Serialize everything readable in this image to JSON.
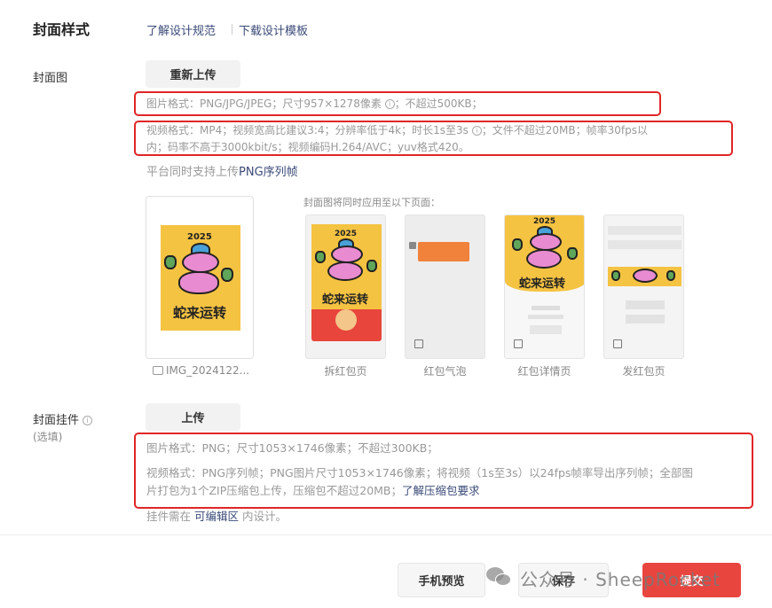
{
  "header": {
    "title": "封面样式",
    "link_spec": "了解设计规范",
    "link_template": "下载设计模板"
  },
  "cover": {
    "label": "封面图",
    "reupload_label": "重新上传",
    "image_format_line": "图片格式：PNG/JPG/JPEG；尺寸957×1278像素",
    "image_format_tail": "；不超过500KB；",
    "video_format_a": "视频格式：MP4；视频宽高比建议3:4；分辨率低于4k；时长1s至3s",
    "video_format_b": "；文件不超过20MB；帧率30fps以",
    "video_format_c": "内；码率不高于3000kbit/s；视频编码H.264/AVC；yuv格式420。",
    "png_seq_prefix": "平台同时支持上传",
    "png_seq_link": "PNG序列帧",
    "file_name": "IMG_2024122...",
    "apply_caption": "封面图将同时应用至以下页面：",
    "pages": [
      "拆红包页",
      "红包气泡",
      "红包详情页",
      "发红包页"
    ],
    "art_year": "2025",
    "art_motto": "蛇来运转"
  },
  "pendant": {
    "label": "封面挂件",
    "optional": "(选填)",
    "upload_label": "上传",
    "image_format": "图片格式：PNG；尺寸1053×1746像素；不超过300KB；",
    "video_format_a": "视频格式：PNG序列帧；PNG图片尺寸1053×1746像素；将视频（1s至3s）以24fps帧率导出序列帧；全部图",
    "video_format_b": "片打包为1个ZIP压缩包上传，压缩包不超过20MB；",
    "video_link": "了解压缩包要求",
    "edit_prefix": "挂件需在",
    "edit_link": "可编辑区",
    "edit_suffix": "内设计。"
  },
  "footer": {
    "preview_label": "手机预览",
    "save_label": "保存",
    "submit_label": "提交",
    "watermark": "公众号 · SheepRocket"
  },
  "colors": {
    "accent_red": "#e9453f",
    "highlight_box": "#e02626",
    "link_blue": "#3a4a78",
    "art_yellow": "#f5c342"
  }
}
